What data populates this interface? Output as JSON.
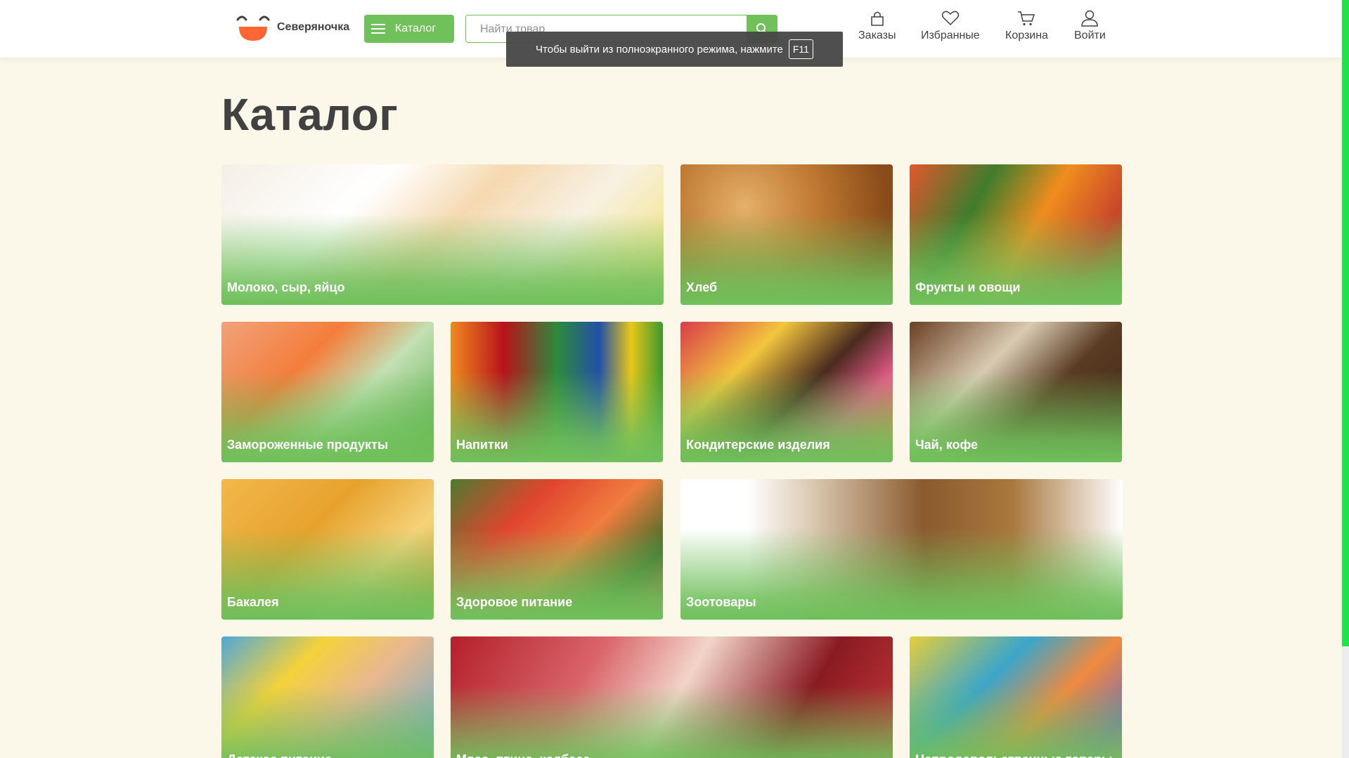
{
  "brand": {
    "name": "Северяночка"
  },
  "header": {
    "catalog_label": "Каталог",
    "search_placeholder": "Найти товар",
    "nav": [
      {
        "label": "Заказы",
        "icon": "bag-icon"
      },
      {
        "label": "Избранные",
        "icon": "heart-icon"
      },
      {
        "label": "Корзина",
        "icon": "cart-icon"
      },
      {
        "label": "Войти",
        "icon": "user-icon"
      }
    ]
  },
  "fullscreen_tooltip": {
    "text": "Чтобы выйти из полноэкранного режима, нажмите",
    "key": "F11"
  },
  "page": {
    "title": "Каталог"
  },
  "categories": [
    {
      "label": "Молоко, сыр, яйцо"
    },
    {
      "label": "Хлеб"
    },
    {
      "label": "Фрукты и овощи"
    },
    {
      "label": "Замороженные продукты"
    },
    {
      "label": "Напитки"
    },
    {
      "label": "Кондитерские изделия"
    },
    {
      "label": "Чай, кофе"
    },
    {
      "label": "Бакалея"
    },
    {
      "label": "Здоровое питание"
    },
    {
      "label": "Зоотовары"
    },
    {
      "label": "Детское питание"
    },
    {
      "label": "Мясо, птица, колбаса"
    },
    {
      "label": "Непродовольственные товары"
    }
  ],
  "colors": {
    "accent": "#70c05b",
    "background": "#fcf8e9",
    "text": "#414141",
    "logo_orange": "#ff6633"
  }
}
